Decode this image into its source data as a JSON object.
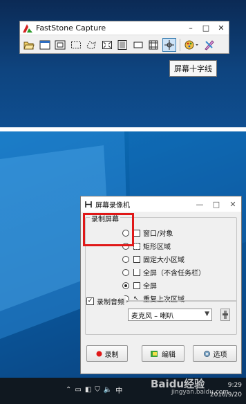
{
  "faststone": {
    "title": "FastStone Capture",
    "controls": {
      "minimize": "–",
      "restore": "□",
      "close": "✕"
    },
    "tools": [
      "open-icon",
      "capture-active-window-icon",
      "capture-window-object-icon",
      "capture-rectangle-icon",
      "capture-freehand-icon",
      "capture-fullscreen-icon",
      "capture-scrolling-icon",
      "capture-fixed-region-icon",
      "screen-recorder-icon",
      "screen-crosshair-icon",
      "output-options-icon",
      "settings-icon"
    ],
    "tooltip": "屏幕十字线"
  },
  "recorder": {
    "title": "屏幕录像机",
    "controls": {
      "minimize": "—",
      "maximize": "□",
      "close": "✕"
    },
    "record_group_label": "录制屏幕",
    "options": [
      {
        "label": "窗口/对象",
        "checked": false
      },
      {
        "label": "矩形区域",
        "checked": false
      },
      {
        "label": "固定大小区域",
        "checked": false
      },
      {
        "label": "全屏（不含任务栏）",
        "checked": false
      },
      {
        "label": "全屏",
        "checked": true
      },
      {
        "label": "重复上次区域",
        "checked": false
      }
    ],
    "audio_label": "录制音频",
    "audio_checked": true,
    "audio_source": "麦克风 – 喇叭",
    "buttons": {
      "record": "录制",
      "edit": "编辑",
      "options": "选项"
    }
  },
  "taskbar": {
    "clock_time": "9:29",
    "clock_date": "2016/9/20",
    "watermark": "Baidu经验",
    "watermark_sub": "jingyan.baidu.com"
  },
  "colors": {
    "highlight": "#e01818",
    "record_dot": "#e01818",
    "accent": "#3c7fb1"
  }
}
